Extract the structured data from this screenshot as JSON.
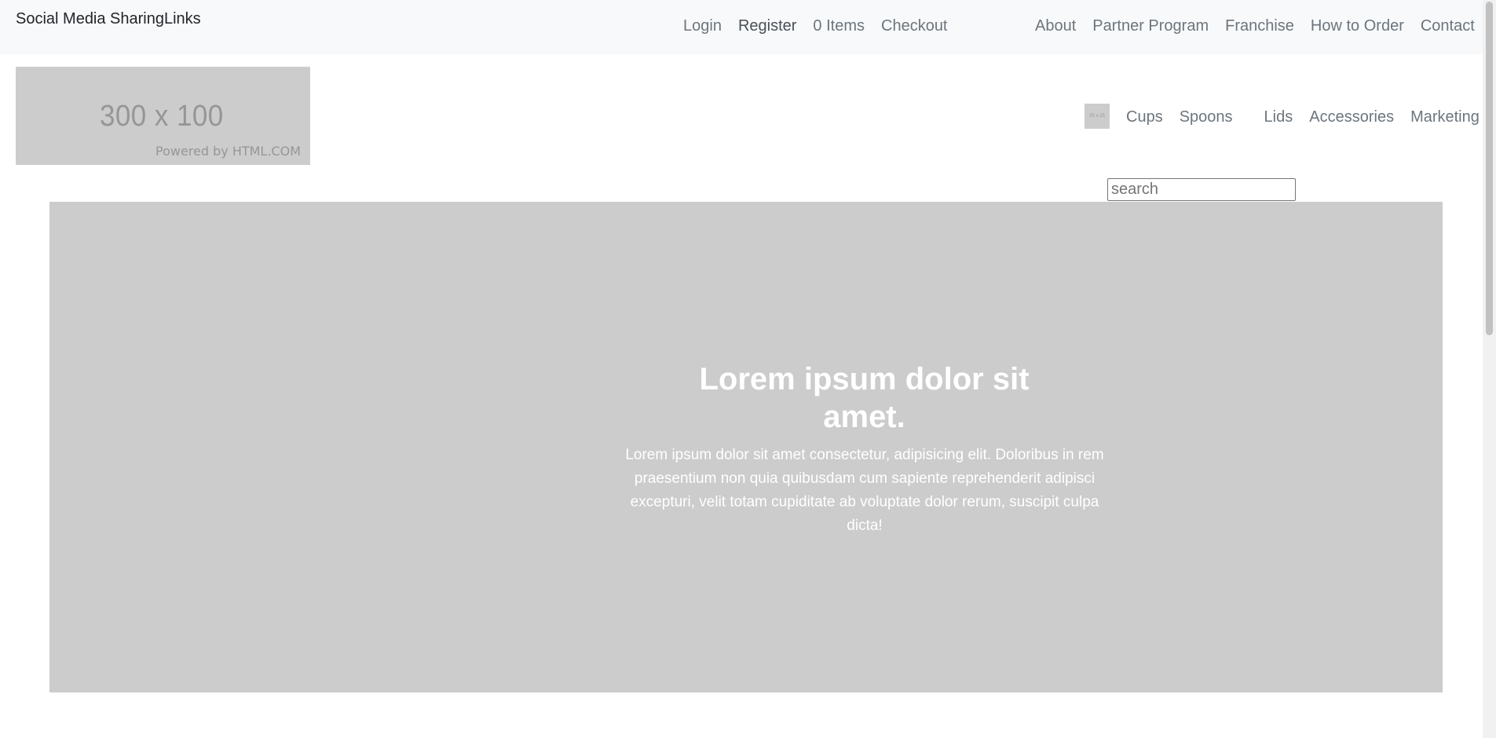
{
  "topbar": {
    "brand": "Social Media SharingLinks",
    "left_links": [
      "Login",
      "Register",
      "0 Items",
      "Checkout"
    ],
    "right_links": [
      "About",
      "Partner Program",
      "Franchise",
      "How to Order",
      "Contact"
    ]
  },
  "logo": {
    "dims": "300 x 100",
    "powered": "Powered by HTML.COM"
  },
  "category_nav": {
    "thumb_text": "25 x 25",
    "items": [
      "Cups",
      "Spoons",
      "Lids",
      "Accessories",
      "Marketing"
    ]
  },
  "search": {
    "placeholder": "search"
  },
  "hero": {
    "title": "Lorem ipsum dolor sit amet.",
    "text": "Lorem ipsum dolor sit amet consectetur, adipisicing elit. Doloribus in rem praesentium non quia quibusdam cum sapiente reprehenderit adipisci excepturi, velit totam cupiditate ab voluptate dolor rerum, suscipit culpa dicta!"
  }
}
